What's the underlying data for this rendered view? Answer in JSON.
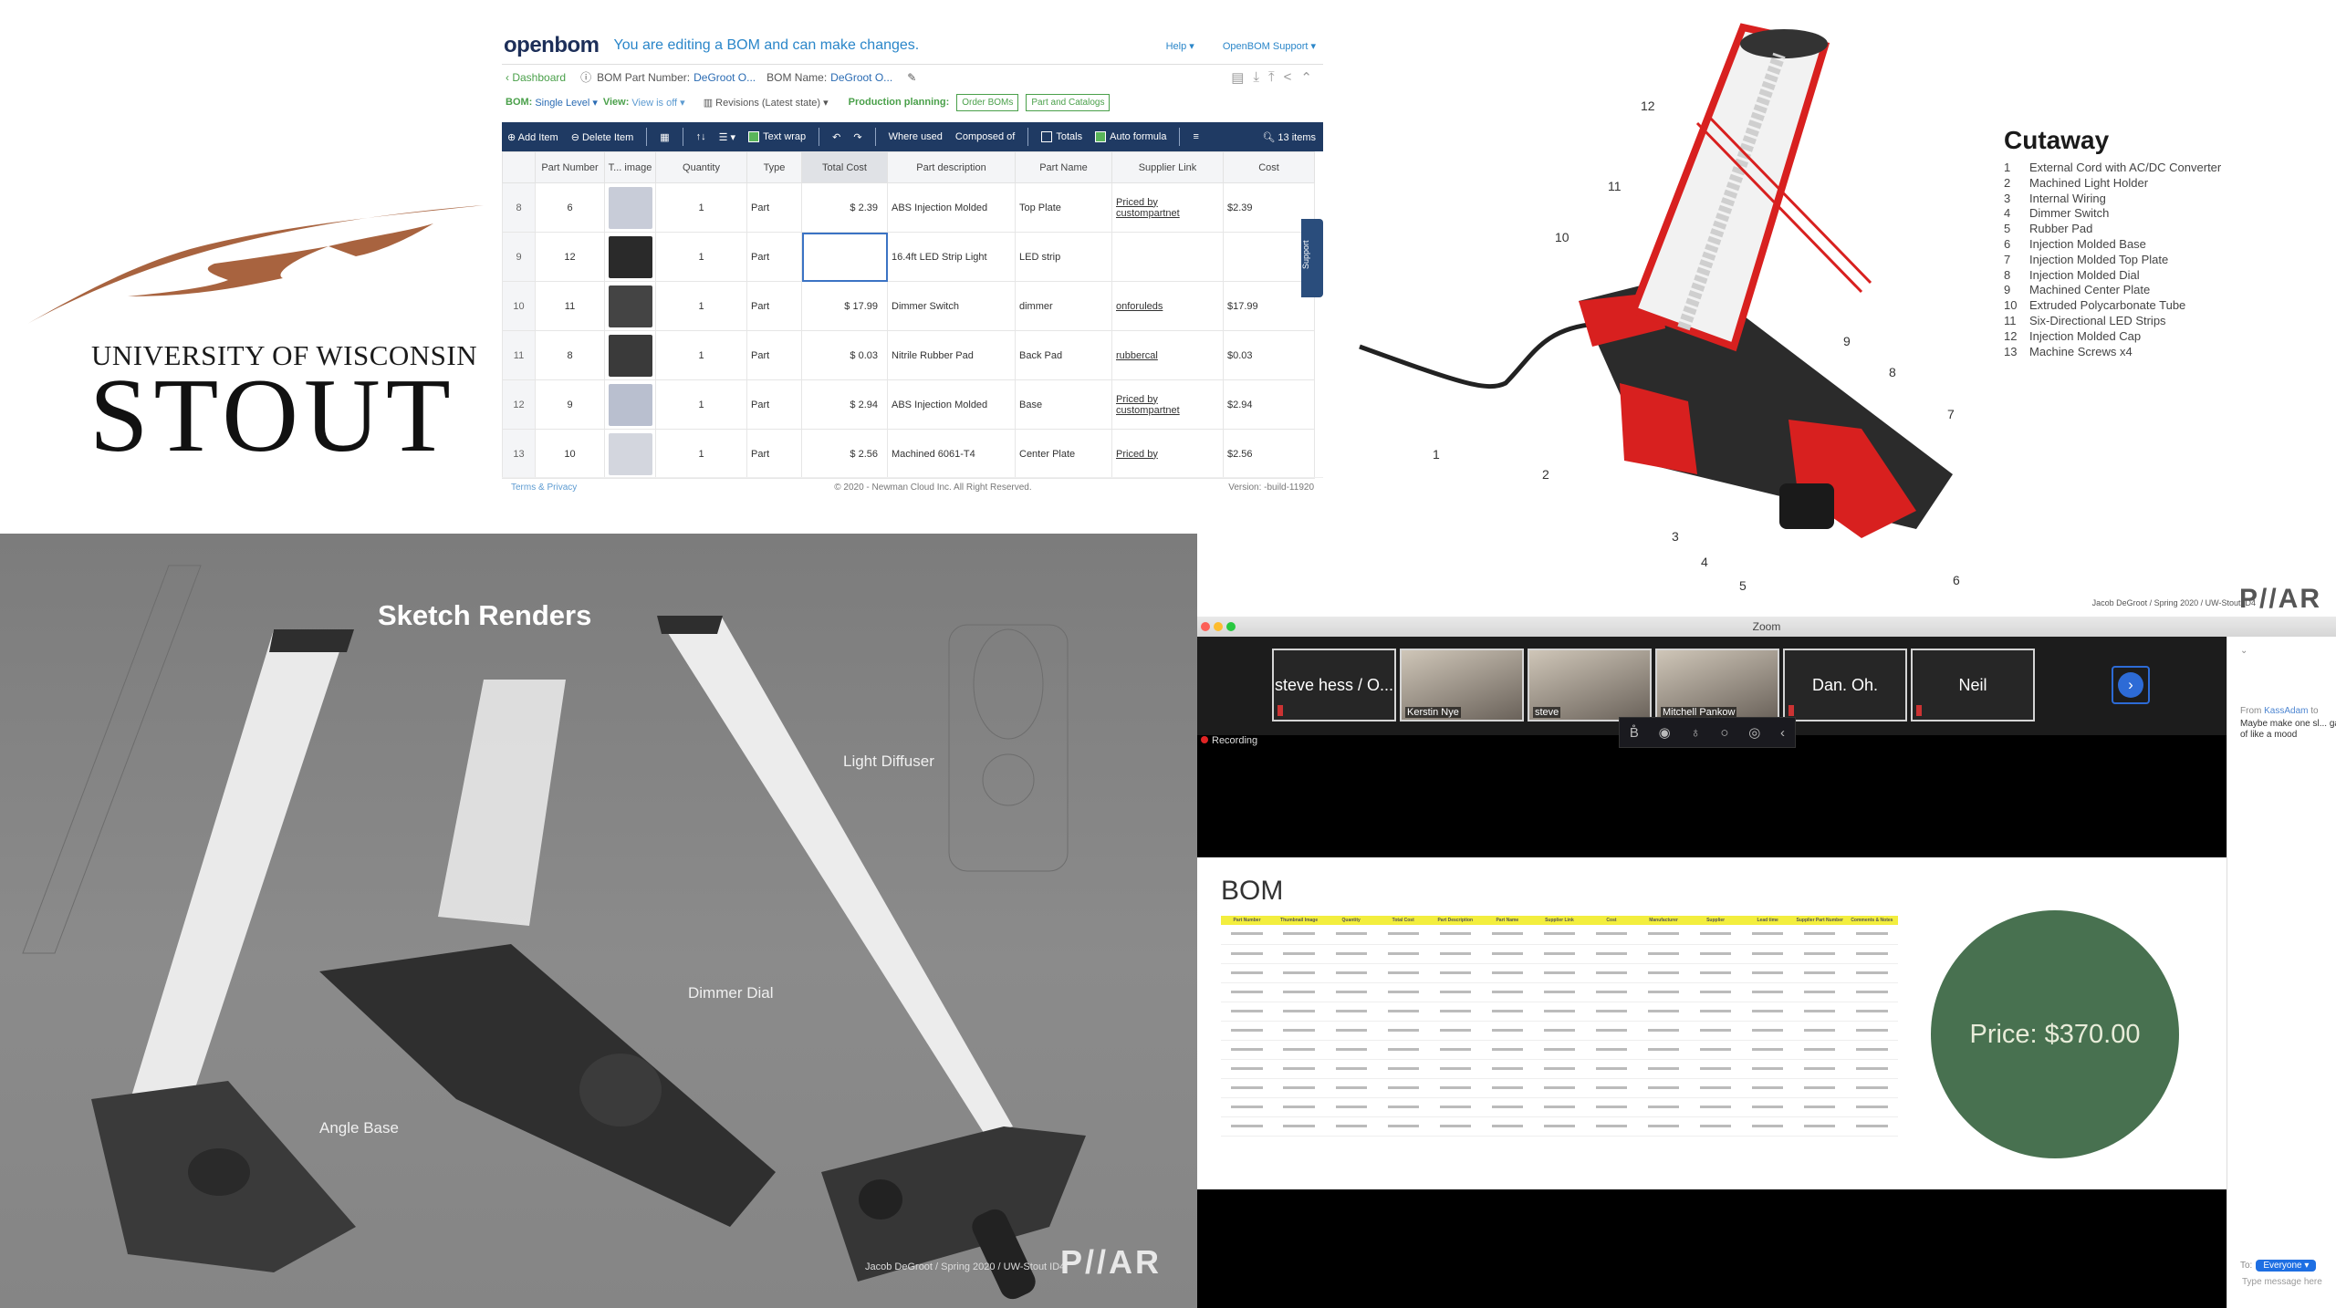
{
  "logo": {
    "line1": "UNIVERSITY OF WISCONSIN",
    "line2": "STOUT",
    "swoosh_color": "#a8633f"
  },
  "openbom": {
    "brand": "openbom",
    "edit_message": "You are editing a BOM and can make changes.",
    "help_label": "Help",
    "support_label": "OpenBOM Support",
    "dashboard_label": "Dashboard",
    "bom_part_number_label": "BOM Part Number:",
    "bom_part_number_value": "DeGroot O...",
    "bom_name_label": "BOM Name:",
    "bom_name_value": "DeGroot O...",
    "bom_label": "BOM:",
    "bom_value": "Single Level",
    "view_label": "View:",
    "view_value": "View is off",
    "revisions_label": "Revisions (Latest state)",
    "production_planning_label": "Production planning:",
    "order_boms_label": "Order BOMs",
    "part_catalogs_label": "Part and Catalogs",
    "toolbar": {
      "add_item": "Add Item",
      "delete_item": "Delete Item",
      "text_wrap": "Text wrap",
      "where_used": "Where used",
      "composed_of": "Composed of",
      "totals": "Totals",
      "auto_formula": "Auto formula",
      "items_count": "13 items"
    },
    "columns": [
      "",
      "Part Number",
      "T... image",
      "Quantity",
      "Type",
      "Total Cost",
      "Part description",
      "Part Name",
      "Supplier Link",
      "Cost"
    ],
    "rows": [
      {
        "row": "8",
        "part_number": "6",
        "quantity": "1",
        "type": "Part",
        "total_cost": "$ 2.39",
        "description": "ABS Injection Molded",
        "name": "Top Plate",
        "supplier": "Priced by custompartnet",
        "cost": "$2.39",
        "thumb": "#c8ccd8"
      },
      {
        "row": "9",
        "part_number": "12",
        "quantity": "1",
        "type": "Part",
        "total_cost": "",
        "description": "16.4ft LED Strip Light",
        "name": "LED strip",
        "supplier": "",
        "cost": "",
        "thumb": "#2a2a2a"
      },
      {
        "row": "10",
        "part_number": "11",
        "quantity": "1",
        "type": "Part",
        "total_cost": "$ 17.99",
        "description": "Dimmer Switch",
        "name": "dimmer",
        "supplier": "onforuleds",
        "cost": "$17.99",
        "thumb": "#444"
      },
      {
        "row": "11",
        "part_number": "8",
        "quantity": "1",
        "type": "Part",
        "total_cost": "$ 0.03",
        "description": "Nitrile Rubber Pad",
        "name": "Back Pad",
        "supplier": "rubbercal",
        "cost": "$0.03",
        "thumb": "#3a3a3a"
      },
      {
        "row": "12",
        "part_number": "9",
        "quantity": "1",
        "type": "Part",
        "total_cost": "$ 2.94",
        "description": "ABS Injection Molded",
        "name": "Base",
        "supplier": "Priced by custompartnet",
        "cost": "$2.94",
        "thumb": "#b9bfcf"
      },
      {
        "row": "13",
        "part_number": "10",
        "quantity": "1",
        "type": "Part",
        "total_cost": "$ 2.56",
        "description": "Machined 6061-T4",
        "name": "Center Plate",
        "supplier": "Priced by",
        "cost": "$2.56",
        "thumb": "#d3d6de"
      }
    ],
    "support_tab": "Support",
    "footer_terms": "Terms",
    "footer_privacy": "Privacy",
    "footer_copyright": "© 2020 - Newman Cloud Inc. All Right Reserved.",
    "footer_version": "Version: -build-11920"
  },
  "cutaway": {
    "title": "Cutaway",
    "items": [
      {
        "n": "1",
        "label": "External Cord with AC/DC Converter"
      },
      {
        "n": "2",
        "label": "Machined Light Holder"
      },
      {
        "n": "3",
        "label": "Internal Wiring"
      },
      {
        "n": "4",
        "label": "Dimmer Switch"
      },
      {
        "n": "5",
        "label": "Rubber Pad"
      },
      {
        "n": "6",
        "label": "Injection Molded Base"
      },
      {
        "n": "7",
        "label": "Injection Molded Top Plate"
      },
      {
        "n": "8",
        "label": "Injection Molded Dial"
      },
      {
        "n": "9",
        "label": "Machined Center Plate"
      },
      {
        "n": "10",
        "label": "Extruded Polycarbonate Tube"
      },
      {
        "n": "11",
        "label": "Six-Directional LED Strips"
      },
      {
        "n": "12",
        "label": "Injection Molded Cap"
      },
      {
        "n": "13",
        "label": "Machine Screws x4"
      }
    ],
    "callouts": [
      "1",
      "2",
      "3",
      "4",
      "5",
      "6",
      "7",
      "8",
      "9",
      "10",
      "11",
      "12"
    ],
    "credit": "Jacob DeGroot / Spring 2020 / UW-Stout ID4",
    "brand": "P//AR",
    "accent": "#d8201f"
  },
  "sketch": {
    "title": "Sketch Renders",
    "labels": {
      "light_diffuser": "Light Diffuser",
      "dimmer_dial": "Dimmer Dial",
      "angle_base": "Angle Base"
    },
    "credit": "Jacob DeGroot / Spring 2020 / UW-Stout ID4",
    "brand": "P//AR"
  },
  "zoom": {
    "window_title": "Zoom",
    "participants": [
      {
        "name": "steve hess / O...",
        "video": false
      },
      {
        "name": "Kerstin Nye",
        "video": true
      },
      {
        "name": "steve",
        "video": true
      },
      {
        "name": "Mitchell Pankow",
        "video": true
      },
      {
        "name": "Dan. Oh.",
        "video": false
      },
      {
        "name": "Neil",
        "video": false
      }
    ],
    "recording_label": "Recording",
    "shared_slide": {
      "title": "BOM",
      "headers": [
        "Part Number",
        "Thumbnail Image",
        "Quantity",
        "Total Cost",
        "Part Description",
        "Part Name",
        "Supplier Link",
        "Cost",
        "Manufacturer",
        "Supplier",
        "Lead time",
        "Supplier Part Number",
        "Comments & Notes"
      ],
      "row_count": 11,
      "price_label": "Price: $370.00",
      "price_color": "#487150"
    },
    "chat": {
      "from_prefix": "From",
      "from_name": "KassAdam",
      "from_suffix": "to",
      "message": "Maybe make one sl... game would help sort of like a mood",
      "to_label": "To:",
      "to_value": "Everyone",
      "input_placeholder": "Type message here"
    }
  }
}
